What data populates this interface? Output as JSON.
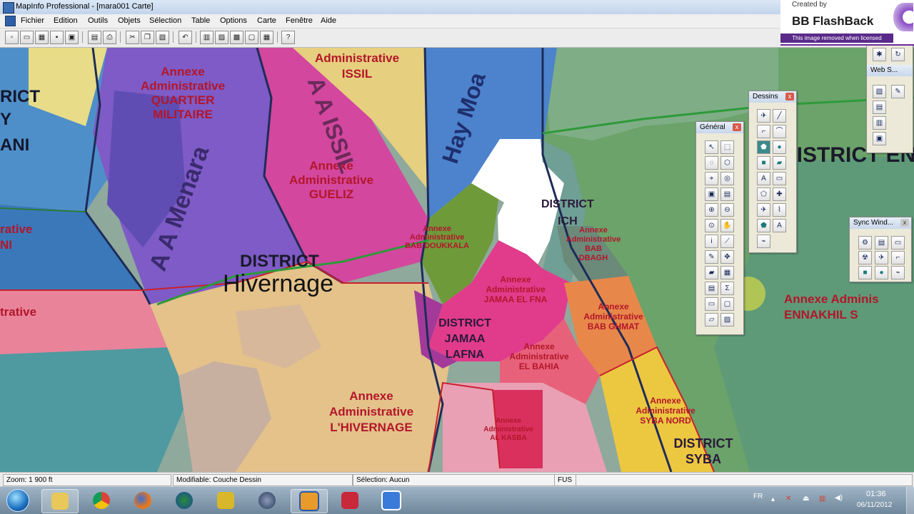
{
  "window": {
    "title": "MapInfo Professional - [mara001 Carte]"
  },
  "menu": [
    "Fichier",
    "Edition",
    "Outils",
    "Objets",
    "Sélection",
    "Table",
    "Options",
    "Carte",
    "Fenêtre",
    "Aide"
  ],
  "toolbar_buttons": [
    "new-icon",
    "open-icon",
    "open-table-icon",
    "save-icon",
    "save-copy-icon",
    "save-workspace-icon",
    "print-icon",
    "cut-icon",
    "copy-icon",
    "paste-icon",
    "undo-icon",
    "new-browser-icon",
    "new-map-icon",
    "new-graph-icon",
    "new-layout-icon",
    "help-icon"
  ],
  "map": {
    "labels": {
      "red1_l1": "Annexe",
      "red1_l2": "Administrative",
      "red1_l3": "QUARTIER",
      "red1_l4": "MILITAIRE",
      "issil_l1": "Administrative",
      "issil_l2": "ISSIL",
      "gueliz_l1": "Annexe",
      "gueliz_l2": "Administrative",
      "gueliz_l3": "GUELIZ",
      "district_left1": "RICT",
      "district_left2": "Y",
      "district_left3": "ANI",
      "left_rative": "rative",
      "left_ni": "NI",
      "left_rative2": "trative",
      "menara": "A A Menara",
      "issil_rot": "A A ISSIL",
      "hay_moa": "Hay Moa",
      "district_hiv1": "DISTRICT",
      "district_hiv2": "Hivernage",
      "bab_doukkala1": "Annexe",
      "bab_doukkala2": "Administrative",
      "bab_doukkala3": "BAB DOUKKALA",
      "district_ich1": "DISTRICT",
      "district_ich2": "ICH",
      "bab_dbagh1": "Annexe",
      "bab_dbagh2": "Administrative",
      "bab_dbagh3": "BAB",
      "bab_dbagh4": "DBAGH",
      "jamaa1": "Annexe",
      "jamaa2": "Administrative",
      "jamaa3": "JAMAA EL FNA",
      "dj1": "DISTRICT",
      "dj2": "JAMAA",
      "dj3": "LAFNA",
      "bahia1": "Annexe",
      "bahia2": "Administrative",
      "bahia3": "EL BAHIA",
      "ghmat1": "Annexe",
      "ghmat2": "Administrative",
      "ghmat3": "BAB GHMAT",
      "hiv1": "Annexe",
      "hiv2": "Administrative",
      "hiv3": "L'HIVERNAGE",
      "kasba1": "Annexe",
      "kasba2": "Administrative",
      "kasba3": "AL KASBA",
      "syba1": "Annexe",
      "syba2": "Administrative",
      "syba3": "SYBA NORD",
      "ds1": "DISTRICT",
      "ds2": "SYBA",
      "district_en": "DISTRICT EN",
      "ennakhil1": "Annexe Adminis",
      "ennakhil2": "ENNAKHIL S"
    }
  },
  "palettes": {
    "general": {
      "title": "Général",
      "close": "x"
    },
    "dessins": {
      "title": "Dessins",
      "close": "x"
    },
    "sync": {
      "title": "Sync Wind...",
      "close": "x"
    },
    "web": {
      "title": "Web S..."
    }
  },
  "watermark": {
    "line1": "Created by",
    "line2": "BB FlashBack",
    "line3": "This image removed when licensed"
  },
  "status": {
    "zoom": "Zoom: 1 900 ft",
    "modifiable": "Modifiable: Couche Dessin",
    "selection": "Sélection: Aucun",
    "fus": "FUS"
  },
  "taskbar": {
    "lang": "FR",
    "time": "01:36",
    "date": "06/11/2012"
  },
  "colors": {
    "accent": "#b3162a"
  }
}
